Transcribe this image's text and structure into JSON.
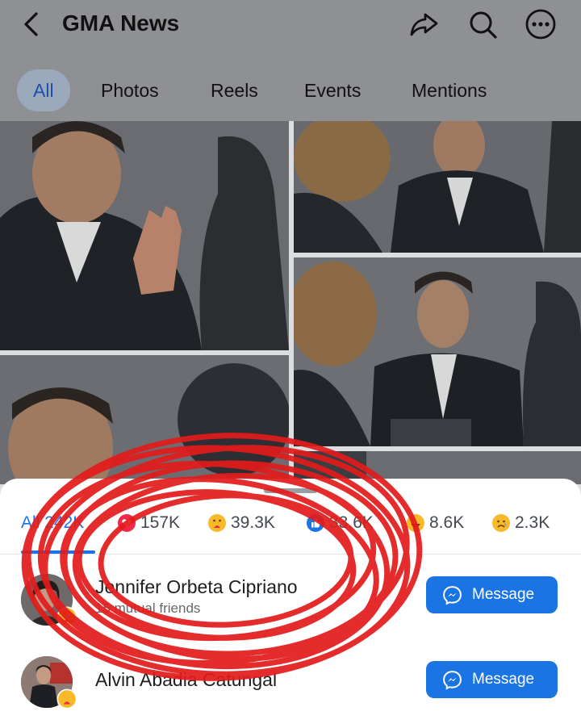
{
  "header": {
    "title": "GMA News",
    "icons": [
      "back-icon",
      "share-icon",
      "search-icon",
      "more-icon"
    ]
  },
  "tabs": [
    {
      "label": "All",
      "active": true
    },
    {
      "label": "Photos",
      "active": false
    },
    {
      "label": "Reels",
      "active": false
    },
    {
      "label": "Events",
      "active": false
    },
    {
      "label": "Mentions",
      "active": false
    }
  ],
  "reactions": {
    "all_label": "All 242K",
    "items": [
      {
        "icon": "love-icon",
        "count": "157K",
        "color": "#f02849"
      },
      {
        "icon": "care-icon",
        "count": "39.3K",
        "color": "#f7b928"
      },
      {
        "icon": "like-icon",
        "count": "33.6K",
        "color": "#1b74e4"
      },
      {
        "icon": "haha-icon",
        "count": "8.6K",
        "color": "#f7b928"
      },
      {
        "icon": "sad-icon",
        "count": "2.3K",
        "color": "#f7b928"
      }
    ]
  },
  "people": [
    {
      "name": "Jennifer Orbeta Cipriano",
      "subtitle": "15 mutual friends",
      "button": "Message",
      "reaction": "care-icon"
    },
    {
      "name": "Alvin Abadia Catungal",
      "subtitle": "",
      "button": "Message",
      "reaction": "care-icon"
    }
  ],
  "colors": {
    "accent": "#1b74e4",
    "scribble": "#e31b1b"
  }
}
